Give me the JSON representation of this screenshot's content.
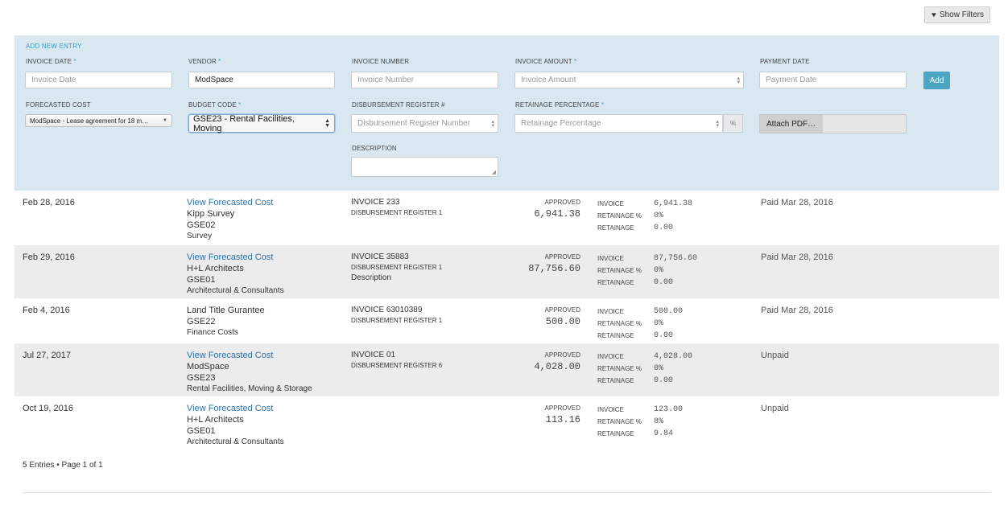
{
  "toolbar": {
    "show_filters_label": "Show Filters",
    "filter_icon": "chevron-down-icon"
  },
  "form": {
    "title": "ADD NEW ENTRY",
    "invoice_date": {
      "label": "INVOICE DATE",
      "required": "*",
      "placeholder": "Invoice Date"
    },
    "vendor": {
      "label": "VENDOR",
      "required": "*",
      "value": "ModSpace"
    },
    "invoice_number": {
      "label": "INVOICE NUMBER",
      "placeholder": "Invoice Number"
    },
    "invoice_amount": {
      "label": "INVOICE AMOUNT",
      "required": "*",
      "placeholder": "Invoice Amount"
    },
    "payment_date": {
      "label": "PAYMENT DATE",
      "placeholder": "Payment Date"
    },
    "add_button": "Add",
    "forecasted_cost": {
      "label": "FORECASTED COST",
      "value": "ModSpace - Lease agreement for 18 m…"
    },
    "budget_code": {
      "label": "BUDGET CODE",
      "required": "*",
      "value": "GSE23 - Rental Facilities, Moving"
    },
    "disbursement": {
      "label": "DISBURSEMENT REGISTER #",
      "placeholder": "Disbursement Register Number"
    },
    "retainage": {
      "label": "RETAINAGE PERCENTAGE",
      "required": "*",
      "placeholder": "Retainage Percentage",
      "suffix": "%"
    },
    "attach_label": "Attach PDF…",
    "description": {
      "label": "DESCRIPTION"
    }
  },
  "detail_labels": {
    "invoice": "INVOICE",
    "retainage_pct": "RETAINAGE %",
    "retainage": "RETAINAGE"
  },
  "entries": [
    {
      "date": "Feb 28, 2016",
      "link": "View Forecasted Cost",
      "vendor": "Kipp Survey",
      "code": "GSE02",
      "category": "Survey",
      "invoice": "INVOICE 233",
      "register": "DISBURSEMENT REGISTER 1",
      "desc": "",
      "status": "APPROVED",
      "amount": "6,941.38",
      "inv_amt": "6,941.38",
      "ret_pct": "0%",
      "ret": "0.00",
      "payment": "Paid Mar 28, 2016"
    },
    {
      "date": "Feb 29, 2016",
      "link": "View Forecasted Cost",
      "vendor": "H+L Architects",
      "code": "GSE01",
      "category": "Architectural & Consultants",
      "invoice": "INVOICE 35883",
      "register": "DISBURSEMENT REGISTER 1",
      "desc": "Description",
      "status": "APPROVED",
      "amount": "87,756.60",
      "inv_amt": "87,756.60",
      "ret_pct": "0%",
      "ret": "0.00",
      "payment": "Paid Mar 28, 2016"
    },
    {
      "date": "Feb 4, 2016",
      "link": "",
      "vendor": "Land Title Gurantee",
      "code": "GSE22",
      "category": "Finance Costs",
      "invoice": "INVOICE 63010389",
      "register": "DISBURSEMENT REGISTER 1",
      "desc": "",
      "status": "APPROVED",
      "amount": "500.00",
      "inv_amt": "500.00",
      "ret_pct": "0%",
      "ret": "0.00",
      "payment": "Paid Mar 28, 2016"
    },
    {
      "date": "Jul 27, 2017",
      "link": "View Forecasted Cost",
      "vendor": "ModSpace",
      "code": "GSE23",
      "category": "Rental Facilities, Moving & Storage",
      "invoice": "INVOICE 01",
      "register": "DISBURSEMENT REGISTER 6",
      "desc": "",
      "status": "APPROVED",
      "amount": "4,028.00",
      "inv_amt": "4,028.00",
      "ret_pct": "0%",
      "ret": "0.00",
      "payment": "Unpaid"
    },
    {
      "date": "Oct 19, 2016",
      "link": "View Forecasted Cost",
      "vendor": "H+L Architects",
      "code": "GSE01",
      "category": "Architectural & Consultants",
      "invoice": "",
      "register": "",
      "desc": "",
      "status": "APPROVED",
      "amount": "113.16",
      "inv_amt": "123.00",
      "ret_pct": "8%",
      "ret": "9.84",
      "payment": "Unpaid"
    }
  ],
  "footer": "5 Entries • Page 1 of 1"
}
